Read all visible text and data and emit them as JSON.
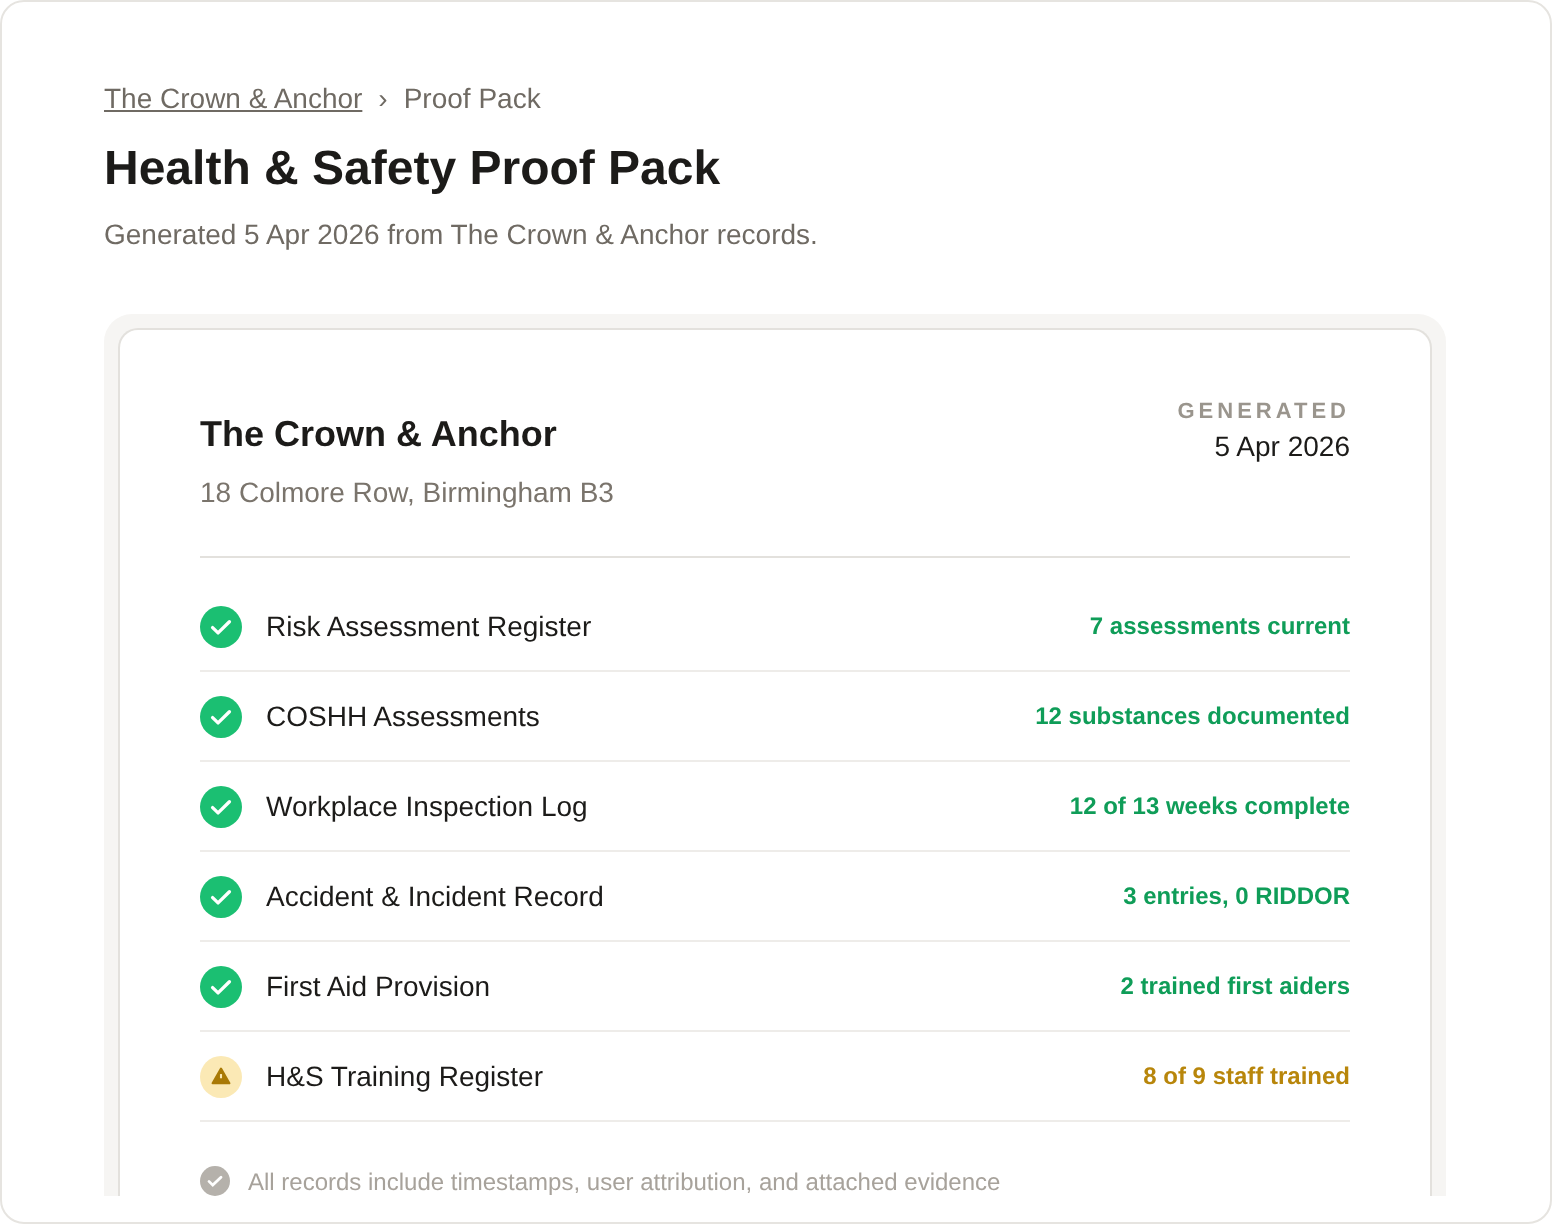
{
  "breadcrumb": {
    "parent": "The Crown & Anchor",
    "separator": "›",
    "current": "Proof Pack"
  },
  "title": "Health & Safety Proof Pack",
  "subtitle": "Generated 5 Apr 2026 from The Crown & Anchor records.",
  "card": {
    "venue": "The Crown & Anchor",
    "address": "18 Colmore Row, Birmingham B3",
    "generated_label": "GENERATED",
    "generated_date": "5 Apr 2026",
    "items": [
      {
        "label": "Risk Assessment Register",
        "summary": "7 assessments current",
        "kind": "ok"
      },
      {
        "label": "COSHH Assessments",
        "summary": "12 substances documented",
        "kind": "ok"
      },
      {
        "label": "Workplace Inspection Log",
        "summary": "12 of 13 weeks complete",
        "kind": "ok"
      },
      {
        "label": "Accident & Incident Record",
        "summary": "3 entries, 0 RIDDOR",
        "kind": "ok"
      },
      {
        "label": "First Aid Provision",
        "summary": "2 trained first aiders",
        "kind": "ok"
      },
      {
        "label": "H&S Training Register",
        "summary": "8 of 9 staff trained",
        "kind": "warn"
      }
    ],
    "footer": "All records include timestamps, user attribution, and attached evidence"
  }
}
